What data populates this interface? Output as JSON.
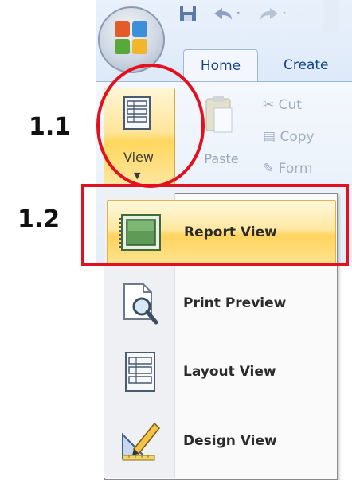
{
  "ribbon": {
    "tabs": [
      {
        "label": "Home"
      },
      {
        "label": "Create"
      }
    ],
    "view_button": {
      "label": "View",
      "icon": "layout-grid-icon"
    },
    "paste_button": {
      "label": "Paste",
      "icon": "paste-icon"
    },
    "clipboard": {
      "cut": "Cut",
      "copy": "Copy",
      "format": "Form"
    }
  },
  "view_menu": {
    "items": [
      {
        "label": "Report View",
        "icon": "report-view-icon",
        "active": true
      },
      {
        "label": "Print Preview",
        "icon": "print-preview-icon",
        "active": false
      },
      {
        "label": "Layout View",
        "icon": "layout-view-icon",
        "active": false
      },
      {
        "label": "Design View",
        "icon": "design-view-icon",
        "active": false
      }
    ]
  },
  "annotations": {
    "step1": "1.1",
    "step2": "1.2",
    "color": "#e3101e"
  }
}
